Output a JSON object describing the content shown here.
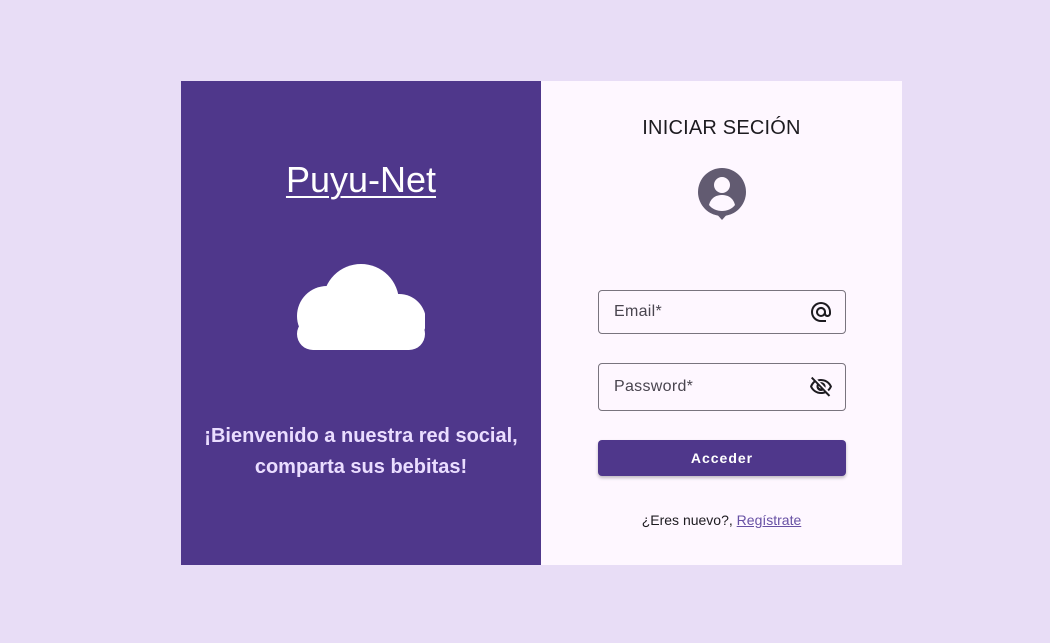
{
  "brand": {
    "name": "Puyu-Net",
    "welcome_line1": "¡Bienvenido a nuestra red social,",
    "welcome_line2": "comparta sus bebitas!",
    "hero_icon": "cloud-icon"
  },
  "login": {
    "title": "INICIAR SECIÓN",
    "avatar_icon": "account-pin-icon",
    "email": {
      "placeholder": "Email*",
      "icon": "at-sign-icon",
      "value": ""
    },
    "password": {
      "placeholder": "Password*",
      "icon": "visibility-off-icon",
      "value": ""
    },
    "submit_label": "Acceder",
    "register_prompt": "¿Eres nuevo?,",
    "register_link": "Regístrate"
  },
  "colors": {
    "page_background": "#e8ddf6",
    "primary": "#4f378b",
    "panel_background": "#fef7ff",
    "link": "#6750a4"
  }
}
